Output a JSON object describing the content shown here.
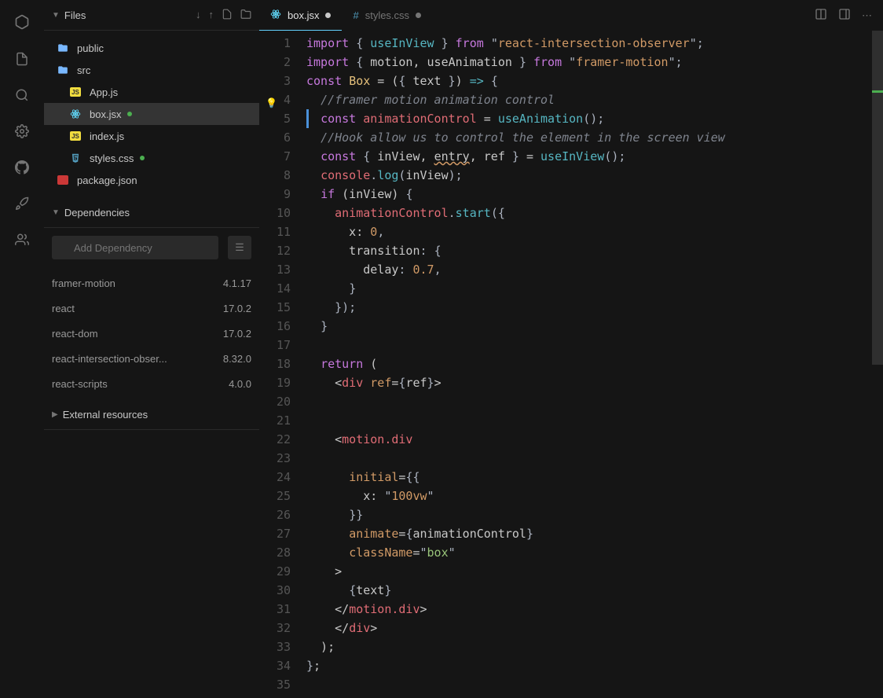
{
  "activity": [
    "cube",
    "file",
    "search",
    "gear",
    "github",
    "rocket",
    "users"
  ],
  "filesPanel": {
    "title": "Files",
    "actions": [
      "download",
      "upload",
      "new-file",
      "new-folder"
    ]
  },
  "fileTree": [
    {
      "name": "public",
      "icon": "folder",
      "depth": 0
    },
    {
      "name": "src",
      "icon": "folder",
      "depth": 0
    },
    {
      "name": "App.js",
      "icon": "js",
      "depth": 1
    },
    {
      "name": "box.jsx",
      "icon": "react",
      "depth": 1,
      "selected": true,
      "dot": "green"
    },
    {
      "name": "index.js",
      "icon": "js",
      "depth": 1
    },
    {
      "name": "styles.css",
      "icon": "css",
      "depth": 1,
      "dot": "green"
    },
    {
      "name": "package.json",
      "icon": "npm",
      "depth": 0
    }
  ],
  "depsPanel": {
    "title": "Dependencies",
    "placeholder": "Add Dependency"
  },
  "deps": [
    {
      "name": "framer-motion",
      "version": "4.1.17"
    },
    {
      "name": "react",
      "version": "17.0.2"
    },
    {
      "name": "react-dom",
      "version": "17.0.2"
    },
    {
      "name": "react-intersection-obser...",
      "version": "8.32.0"
    },
    {
      "name": "react-scripts",
      "version": "4.0.0"
    }
  ],
  "extPanel": {
    "title": "External resources"
  },
  "tabs": [
    {
      "label": "box.jsx",
      "icon": "react",
      "active": true,
      "modified": true
    },
    {
      "label": "styles.css",
      "icon": "css",
      "active": false,
      "modified": true
    }
  ],
  "code": [
    [
      [
        "kw",
        "import"
      ],
      [
        "plain",
        " "
      ],
      [
        "punc",
        "{"
      ],
      [
        "plain",
        " "
      ],
      [
        "fn",
        "useInView"
      ],
      [
        "plain",
        " "
      ],
      [
        "punc",
        "}"
      ],
      [
        "plain",
        " "
      ],
      [
        "kw",
        "from"
      ],
      [
        "plain",
        " "
      ],
      [
        "punc",
        "\""
      ],
      [
        "pkg",
        "react-intersection-observer"
      ],
      [
        "punc",
        "\";"
      ]
    ],
    [
      [
        "kw",
        "import"
      ],
      [
        "plain",
        " "
      ],
      [
        "punc",
        "{"
      ],
      [
        "plain",
        " motion, useAnimation "
      ],
      [
        "punc",
        "}"
      ],
      [
        "plain",
        " "
      ],
      [
        "kw",
        "from"
      ],
      [
        "plain",
        " "
      ],
      [
        "punc",
        "\""
      ],
      [
        "pkg",
        "framer-motion"
      ],
      [
        "punc",
        "\";"
      ]
    ],
    [
      [
        "kw",
        "const"
      ],
      [
        "plain",
        " "
      ],
      [
        "id",
        "Box"
      ],
      [
        "plain",
        " = ("
      ],
      [
        "punc",
        "{"
      ],
      [
        "plain",
        " text "
      ],
      [
        "punc",
        "}"
      ],
      [
        "plain",
        ") "
      ],
      [
        "fn",
        "=>"
      ],
      [
        "plain",
        " "
      ],
      [
        "punc",
        "{"
      ]
    ],
    [
      [
        "plain",
        "  "
      ],
      [
        "comment",
        "//framer motion animation control"
      ]
    ],
    [
      [
        "plain",
        "  "
      ],
      [
        "kw",
        "const"
      ],
      [
        "plain",
        " "
      ],
      [
        "var",
        "animationControl"
      ],
      [
        "plain",
        " = "
      ],
      [
        "fn",
        "useAnimation"
      ],
      [
        "punc",
        "();"
      ]
    ],
    [
      [
        "plain",
        "  "
      ],
      [
        "comment",
        "//Hook allow us to control the element in the screen view"
      ]
    ],
    [
      [
        "plain",
        "  "
      ],
      [
        "kw",
        "const"
      ],
      [
        "plain",
        " "
      ],
      [
        "punc",
        "{"
      ],
      [
        "plain",
        " inView, "
      ],
      [
        "lint",
        "entry"
      ],
      [
        "plain",
        ", ref "
      ],
      [
        "punc",
        "}"
      ],
      [
        "plain",
        " = "
      ],
      [
        "fn",
        "useInView"
      ],
      [
        "punc",
        "();"
      ]
    ],
    [
      [
        "plain",
        "  "
      ],
      [
        "var",
        "console"
      ],
      [
        "punc",
        "."
      ],
      [
        "fn",
        "log"
      ],
      [
        "punc",
        "("
      ],
      [
        "plain",
        "inView"
      ],
      [
        "punc",
        ");"
      ]
    ],
    [
      [
        "plain",
        "  "
      ],
      [
        "kw",
        "if"
      ],
      [
        "plain",
        " (inView) "
      ],
      [
        "punc",
        "{"
      ]
    ],
    [
      [
        "plain",
        "    "
      ],
      [
        "var",
        "animationControl"
      ],
      [
        "punc",
        "."
      ],
      [
        "fn",
        "start"
      ],
      [
        "punc",
        "("
      ],
      [
        "punc",
        "{"
      ]
    ],
    [
      [
        "plain",
        "      x: "
      ],
      [
        "num",
        "0"
      ],
      [
        "punc",
        ","
      ]
    ],
    [
      [
        "plain",
        "      transition"
      ],
      [
        "punc",
        ":"
      ],
      [
        "plain",
        " "
      ],
      [
        "punc",
        "{"
      ]
    ],
    [
      [
        "plain",
        "        delay"
      ],
      [
        "punc",
        ":"
      ],
      [
        "plain",
        " "
      ],
      [
        "num",
        "0.7"
      ],
      [
        "punc",
        ","
      ]
    ],
    [
      [
        "plain",
        "      "
      ],
      [
        "punc",
        "}"
      ]
    ],
    [
      [
        "plain",
        "    "
      ],
      [
        "punc",
        "}"
      ],
      [
        "punc",
        ");"
      ]
    ],
    [
      [
        "plain",
        "  "
      ],
      [
        "punc",
        "}"
      ]
    ],
    [],
    [
      [
        "plain",
        "  "
      ],
      [
        "kw",
        "return"
      ],
      [
        "plain",
        " ("
      ]
    ],
    [
      [
        "plain",
        "    <"
      ],
      [
        "var",
        "div"
      ],
      [
        "plain",
        " "
      ],
      [
        "prop",
        "ref"
      ],
      [
        "plain",
        "="
      ],
      [
        "punc",
        "{"
      ],
      [
        "plain",
        "ref"
      ],
      [
        "punc",
        "}"
      ],
      [
        "plain",
        ">"
      ]
    ],
    [],
    [],
    [
      [
        "plain",
        "    <"
      ],
      [
        "var",
        "motion.div"
      ]
    ],
    [],
    [
      [
        "plain",
        "      "
      ],
      [
        "prop",
        "initial"
      ],
      [
        "plain",
        "="
      ],
      [
        "punc",
        "{"
      ],
      [
        "punc",
        "{"
      ]
    ],
    [
      [
        "plain",
        "        x: "
      ],
      [
        "punc",
        "\""
      ],
      [
        "num",
        "100vw"
      ],
      [
        "punc",
        "\""
      ]
    ],
    [
      [
        "plain",
        "      "
      ],
      [
        "punc",
        "}"
      ],
      [
        "punc",
        "}"
      ]
    ],
    [
      [
        "plain",
        "      "
      ],
      [
        "prop",
        "animate"
      ],
      [
        "plain",
        "="
      ],
      [
        "punc",
        "{"
      ],
      [
        "plain",
        "animationControl"
      ],
      [
        "punc",
        "}"
      ]
    ],
    [
      [
        "plain",
        "      "
      ],
      [
        "prop",
        "className"
      ],
      [
        "plain",
        "="
      ],
      [
        "punc",
        "\""
      ],
      [
        "str",
        "box"
      ],
      [
        "punc",
        "\""
      ]
    ],
    [
      [
        "plain",
        "    >"
      ]
    ],
    [
      [
        "plain",
        "      "
      ],
      [
        "punc",
        "{"
      ],
      [
        "plain",
        "text"
      ],
      [
        "punc",
        "}"
      ]
    ],
    [
      [
        "plain",
        "    </"
      ],
      [
        "var",
        "motion.div"
      ],
      [
        "plain",
        ">"
      ]
    ],
    [
      [
        "plain",
        "    </"
      ],
      [
        "var",
        "div"
      ],
      [
        "plain",
        ">"
      ]
    ],
    [
      [
        "plain",
        "  );"
      ]
    ],
    [
      [
        "punc",
        "}"
      ],
      [
        "plain",
        ";"
      ]
    ],
    []
  ],
  "highlightLine": 5,
  "bulbLine": 4
}
